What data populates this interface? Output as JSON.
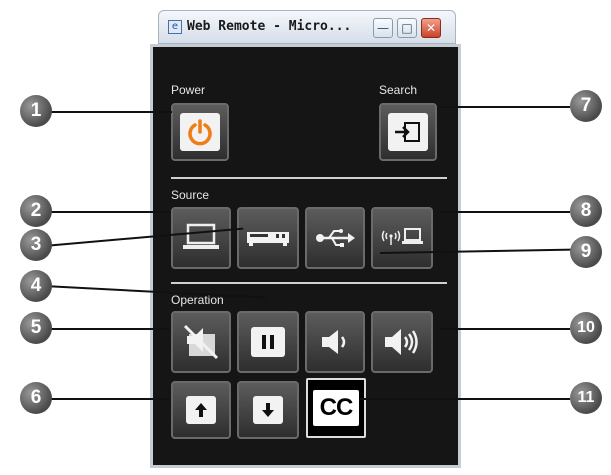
{
  "window": {
    "title": "Web Remote - Micro...",
    "minimize_glyph": "—",
    "maximize_glyph": "□",
    "close_glyph": "✕"
  },
  "sections": {
    "power_label": "Power",
    "search_label": "Search",
    "source_label": "Source",
    "operation_label": "Operation"
  },
  "callouts": [
    "1",
    "2",
    "3",
    "4",
    "5",
    "6",
    "7",
    "8",
    "9",
    "10",
    "11"
  ],
  "icons": {
    "power": "power-icon",
    "search": "search-source-icon",
    "computer": "laptop-icon",
    "video": "video-device-icon",
    "usb": "usb-icon",
    "network": "network-icon",
    "av_mute": "av-mute-icon",
    "freeze": "pause-icon",
    "vol_down": "volume-down-icon",
    "vol_up": "volume-up-icon",
    "page_up": "arrow-up-icon",
    "page_down": "arrow-down-icon",
    "cc": "closed-caption-icon"
  },
  "cc_text": "CC",
  "colors": {
    "power_accent": "#f07d14",
    "panel_bg": "#151515"
  }
}
